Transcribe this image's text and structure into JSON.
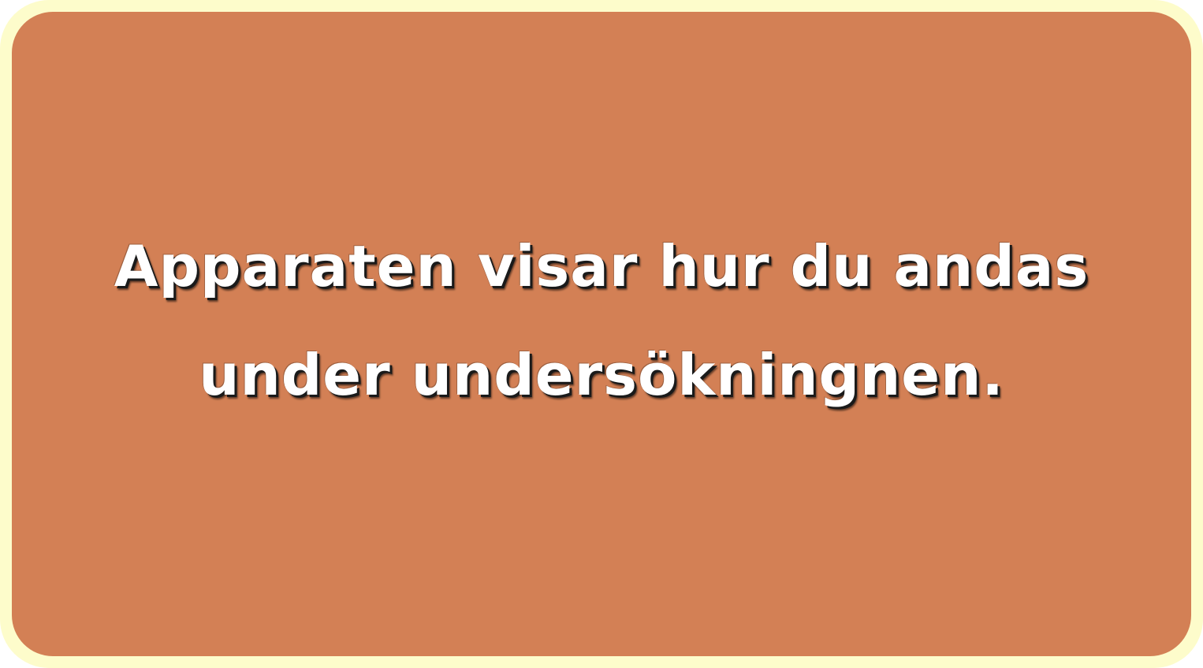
{
  "colors": {
    "frame": "#fdfccb",
    "card": "#d38055",
    "text": "#ffffff",
    "text_shadow": "#1a1a1a"
  },
  "caption": {
    "line1": "Apparaten visar hur du andas",
    "line2": "under undersökningnen."
  }
}
